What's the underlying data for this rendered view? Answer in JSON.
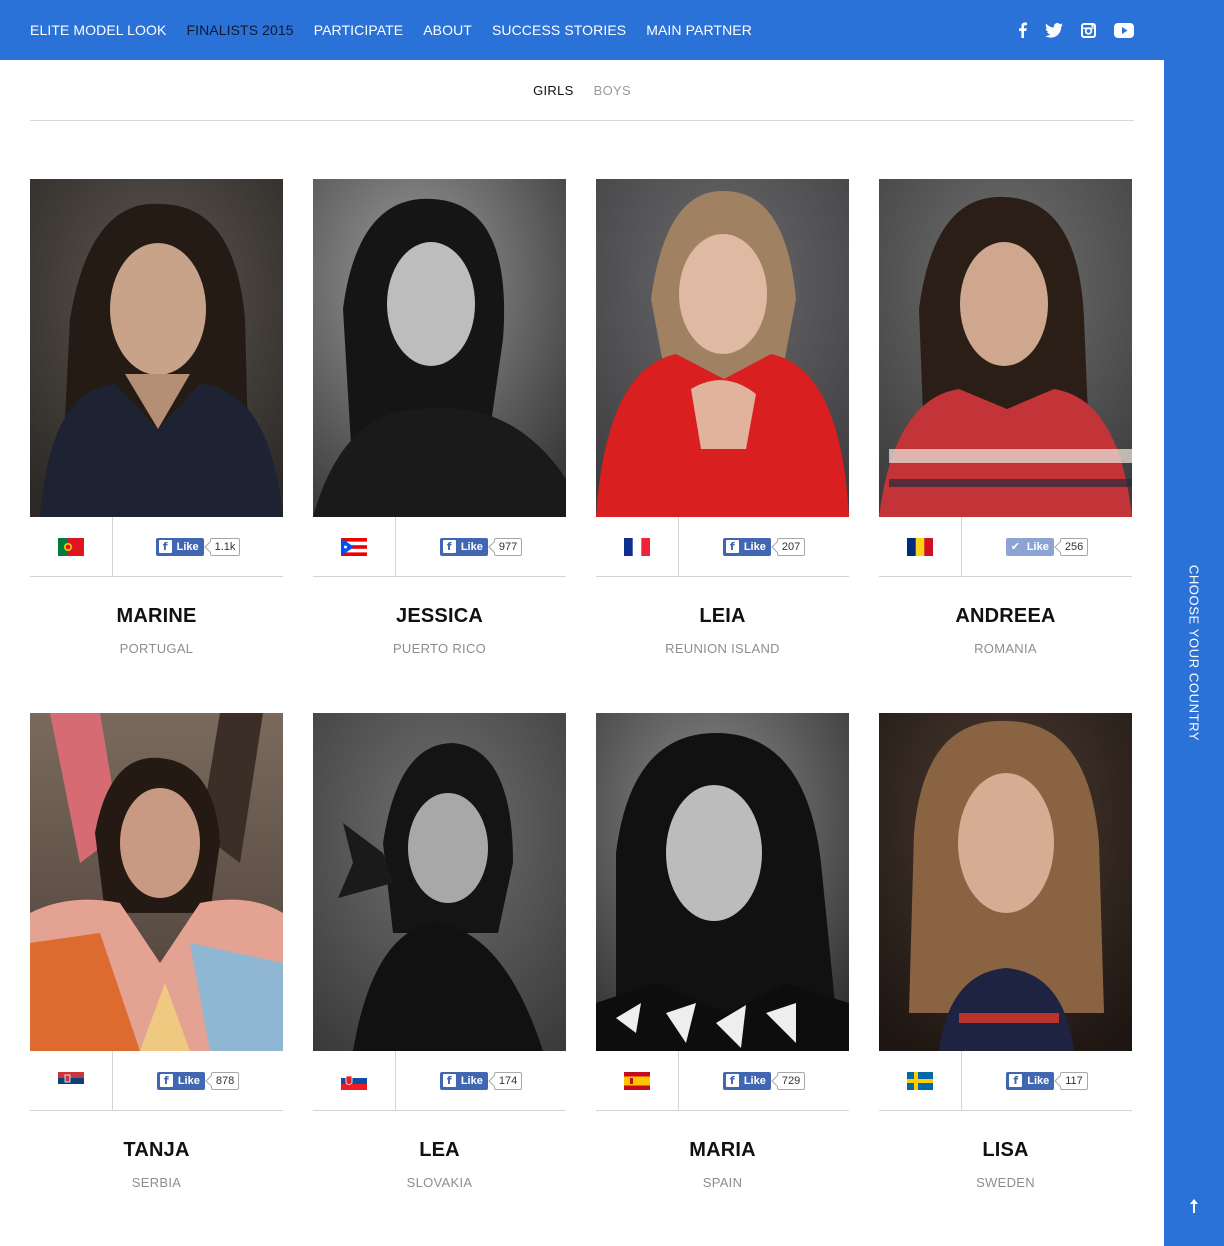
{
  "nav": {
    "items": [
      {
        "label": "ELITE MODEL LOOK"
      },
      {
        "label": "FINALISTS 2015"
      },
      {
        "label": "PARTICIPATE"
      },
      {
        "label": "ABOUT"
      },
      {
        "label": "SUCCESS STORIES"
      },
      {
        "label": "MAIN PARTNER"
      }
    ],
    "social_icons": [
      "facebook-icon",
      "twitter-icon",
      "instagram-icon",
      "youtube-icon"
    ]
  },
  "tabs": {
    "girls": "GIRLS",
    "boys": "BOYS"
  },
  "side": {
    "label": "CHOOSE YOUR COUNTRY",
    "icon": "arrow-up-icon"
  },
  "like_label": "Like",
  "colors": {
    "brand_blue": "#2b72d8",
    "facebook_blue": "#4267b2"
  },
  "finalists": [
    {
      "name": "MARINE",
      "country": "PORTUGAL",
      "likes": "1.1k",
      "liked": false
    },
    {
      "name": "JESSICA",
      "country": "PUERTO RICO",
      "likes": "977",
      "liked": false
    },
    {
      "name": "LEIA",
      "country": "REUNION ISLAND",
      "likes": "207",
      "liked": false
    },
    {
      "name": "ANDREEA",
      "country": "ROMANIA",
      "likes": "256",
      "liked": true
    },
    {
      "name": "TANJA",
      "country": "SERBIA",
      "likes": "878",
      "liked": false
    },
    {
      "name": "LEA",
      "country": "SLOVAKIA",
      "likes": "174",
      "liked": false
    },
    {
      "name": "MARIA",
      "country": "SPAIN",
      "likes": "729",
      "liked": false
    },
    {
      "name": "LISA",
      "country": "SWEDEN",
      "likes": "117",
      "liked": false
    }
  ]
}
